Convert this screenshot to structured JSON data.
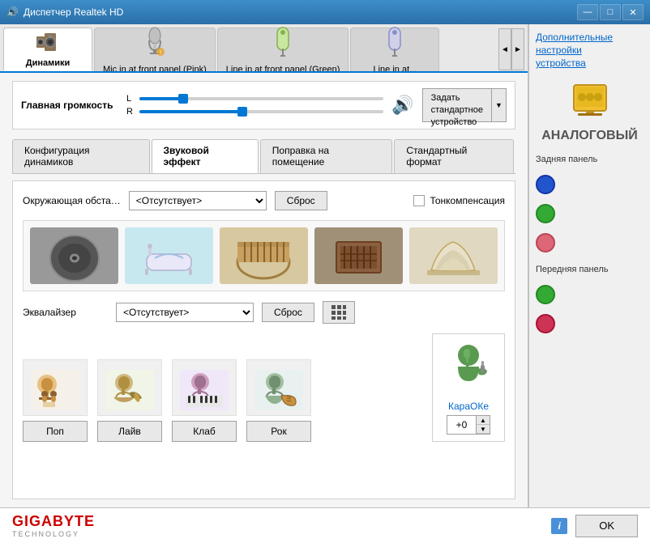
{
  "titlebar": {
    "title": "Диспетчер Realtek HD",
    "icon": "🔊",
    "min_btn": "—",
    "max_btn": "□",
    "close_btn": "✕"
  },
  "device_tabs": [
    {
      "id": "dynamics",
      "label": "Динамики",
      "icon": "🔊",
      "active": true
    },
    {
      "id": "mic_front",
      "label": "Mic in at front panel (Pink)",
      "icon": "🎤"
    },
    {
      "id": "line_front",
      "label": "Line in at front panel (Green)",
      "icon": "🎧"
    },
    {
      "id": "line_in",
      "label": "Line in at...",
      "icon": "🔌"
    }
  ],
  "scroll_left": "◄",
  "scroll_right": "►",
  "volume": {
    "label": "Главная громкость",
    "l_label": "L",
    "r_label": "R",
    "l_position_pct": 18,
    "r_position_pct": 42,
    "icon": "🔊",
    "set_default_label": "Задать\nстандартное\nустройство",
    "set_default_arrow": "▼"
  },
  "sub_tabs": [
    {
      "id": "config",
      "label": "Конфигурация динамиков"
    },
    {
      "id": "effect",
      "label": "Звуковой эффект",
      "active": true
    },
    {
      "id": "room",
      "label": "Поправка на помещение"
    },
    {
      "id": "format",
      "label": "Стандартный формат"
    }
  ],
  "effect_panel": {
    "env_label": "Окружающая обста…",
    "env_value": "<Отсутствует>",
    "reset_label": "Сброс",
    "tone_comp_label": "Тонкомпенсация",
    "environments": [
      {
        "id": "disc",
        "emoji": "💿",
        "color": "#888"
      },
      {
        "id": "bath",
        "emoji": "🛁",
        "color": "#a8c8e8"
      },
      {
        "id": "colosseum",
        "emoji": "🏛",
        "color": "#c8a870"
      },
      {
        "id": "stone",
        "emoji": "📦",
        "color": "#8B7355"
      },
      {
        "id": "opera",
        "emoji": "🏰",
        "color": "#d4c8b0"
      }
    ],
    "eq_label": "Эквалайзер",
    "eq_value": "<Отсутствует>",
    "eq_reset_label": "Сброс",
    "eq_icon": "⊞",
    "presets": [
      {
        "id": "pop",
        "icon": "🎤",
        "label": "Поп",
        "emoji": "🧑‍🎤"
      },
      {
        "id": "live",
        "icon": "🎸",
        "label": "Лайв",
        "emoji": "🧑‍🎸"
      },
      {
        "id": "club",
        "icon": "🎹",
        "label": "Клаб",
        "emoji": "🧑‍🎹"
      },
      {
        "id": "rock",
        "icon": "🎸",
        "label": "Рок",
        "emoji": "🧑‍🎸"
      }
    ],
    "karaoke_label": "КараОКе",
    "karaoke_value": "+0"
  },
  "right_panel": {
    "link_text": "Дополнительные\nнастройки\nустройства",
    "section_title": "АНАЛОГОВЫЙ",
    "back_panel_label": "Задняя панель",
    "back_connectors": [
      {
        "color": "#2255cc",
        "hex": "#2255cc"
      },
      {
        "color": "#33aa33",
        "hex": "#33aa33"
      },
      {
        "color": "#dd6677",
        "hex": "#dd6677"
      }
    ],
    "front_panel_label": "Передняя панель",
    "front_connectors": [
      {
        "color": "#33aa33",
        "hex": "#33aa33"
      },
      {
        "color": "#cc3355",
        "hex": "#cc3355"
      }
    ]
  },
  "bottom": {
    "gigabyte_text": "GIGABYTE",
    "gigabyte_sub": "TECHNOLOGY",
    "ok_label": "OK",
    "info_icon": "i"
  }
}
